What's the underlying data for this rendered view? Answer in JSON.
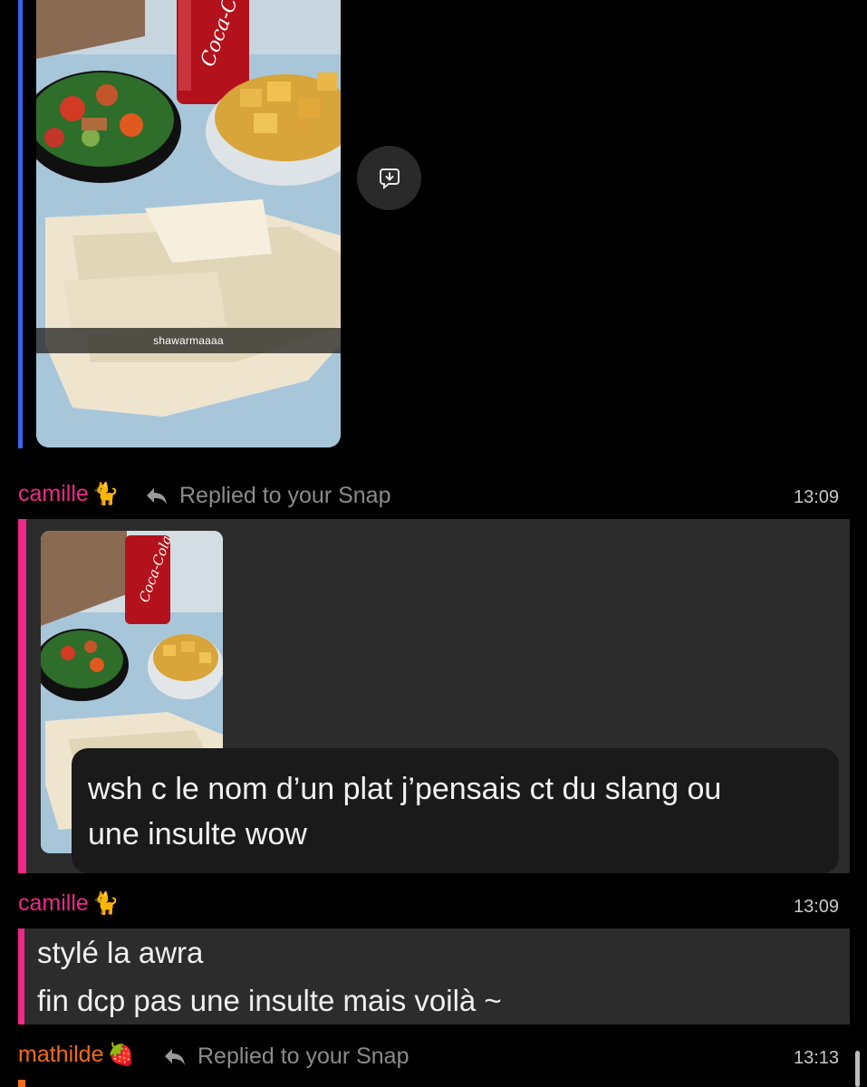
{
  "snap_top": {
    "caption": "shawarmaaaa"
  },
  "messages": [
    {
      "sender": "camille",
      "emoji": "🐈",
      "reply_label": "Replied to your Snap",
      "time": "13:09",
      "text_lines": [
        "wsh c le nom d’un plat j’pensais ct du slang ou",
        "une insulte wow"
      ]
    },
    {
      "sender": "camille",
      "emoji": "🐈",
      "time": "13:09",
      "text_lines": [
        "stylé la awra",
        "fin dcp pas une insulte mais voilà ~"
      ]
    },
    {
      "sender": "mathilde",
      "emoji": "🍓",
      "reply_label": "Replied to your Snap",
      "time": "13:13"
    }
  ],
  "colors": {
    "camille": "#f0288a",
    "mathilde": "#f36b1c",
    "snap_bar": "#3a63f0"
  },
  "icons": [
    "save-to-chat-icon",
    "reply-arrow-icon"
  ]
}
